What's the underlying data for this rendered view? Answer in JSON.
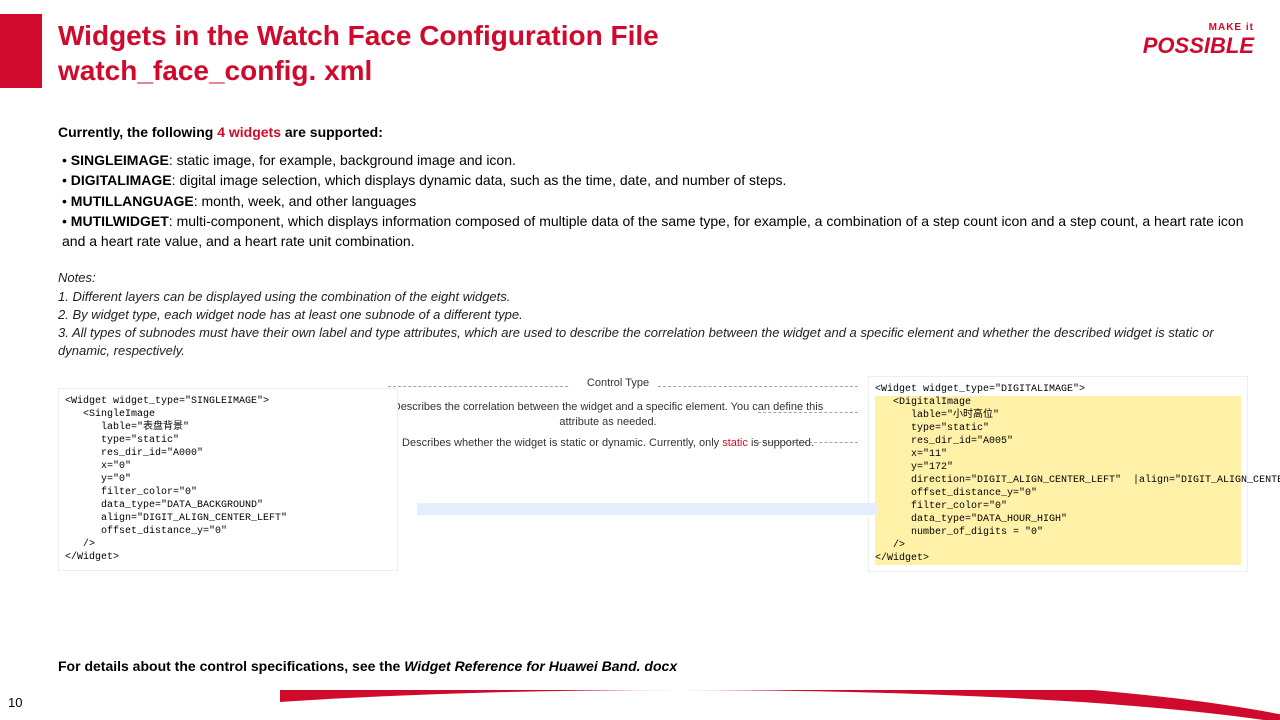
{
  "title_line1": "Widgets in the Watch Face Configuration File",
  "title_line2": "watch_face_config. xml",
  "logo": {
    "line1": "MAKE it",
    "line2": "POSSIBLE"
  },
  "intro_pre": "Currently, the following ",
  "intro_strong": "4 widgets",
  "intro_post": " are supported:",
  "widgets": [
    {
      "name": "SINGLEIMAGE",
      "desc": ": static image, for example, background image and icon."
    },
    {
      "name": "DIGITALIMAGE",
      "desc": ": digital image selection, which displays dynamic data, such as the time, date, and number of steps."
    },
    {
      "name": "MUTILLANGUAGE",
      "desc": ": month, week, and other languages"
    },
    {
      "name": "MUTILWIDGET",
      "desc": ": multi-component, which displays information composed of multiple data of the same type, for example, a combination of a step count icon and a step count, a heart rate icon and a heart rate value, and a heart rate unit combination."
    }
  ],
  "notes_title": "Notes:",
  "notes": [
    "1. Different layers can be displayed using the combination of the eight widgets.",
    "2. By widget type, each widget node has at least one subnode of a different type.",
    "3. All types of subnodes must have their own label and type attributes, which are used to describe the correlation between the widget and a specific element and whether the described widget is static or dynamic, respectively."
  ],
  "callouts": {
    "c1": "Control Type",
    "c2": "Describes the correlation between the widget and a specific element. You can define this attribute as needed.",
    "c3_pre": "Describes whether the widget is static or dynamic. Currently, only ",
    "c3_red": "static",
    "c3_post": " is supported."
  },
  "left_code": "<Widget widget_type=\"SINGLEIMAGE\">\n   <SingleImage\n      lable=\"表盘背景\"\n      type=\"static\"\n      res_dir_id=\"A000\"\n      x=\"0\"\n      y=\"0\"\n      filter_color=\"0\"\n      data_type=\"DATA_BACKGROUND\"\n      align=\"DIGIT_ALIGN_CENTER_LEFT\"\n      offset_distance_y=\"0\"\n   />\n</Widget>",
  "right_code_open": "<Widget widget_type=\"DIGITALIMAGE\">",
  "right_code_inner": "   <DigitalImage\n      lable=\"小时高位\"\n      type=\"static\"\n      res_dir_id=\"A005\"\n      x=\"11\"\n      y=\"172\"",
  "right_code_dir": "      direction=\"DIGIT_ALIGN_CENTER_LEFT\"  |align=\"DIGIT_ALIGN_CENTER_LEFT\"",
  "right_code_tail": "      offset_distance_y=\"0\"\n      filter_color=\"0\"\n      data_type=\"DATA_HOUR_HIGH\"\n      number_of_digits = \"0\"\n   />\n</Widget>",
  "footer_pre": "For details about the control specifications, see the ",
  "footer_doc": "Widget Reference for Huawei Band. docx",
  "page": "10"
}
